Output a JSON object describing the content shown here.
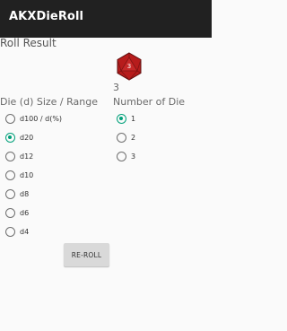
{
  "app": {
    "title": "AKXDieRoll"
  },
  "result": {
    "heading": "Roll Result",
    "die_icon": "d20-die-icon",
    "die_face": "3",
    "value": "3"
  },
  "size_group": {
    "header": "Die (d) Size / Range",
    "options": [
      {
        "label": "d100 / d(%)",
        "checked": false
      },
      {
        "label": "d20",
        "checked": true
      },
      {
        "label": "d12",
        "checked": false
      },
      {
        "label": "d10",
        "checked": false
      },
      {
        "label": "d8",
        "checked": false
      },
      {
        "label": "d6",
        "checked": false
      },
      {
        "label": "d4",
        "checked": false
      }
    ]
  },
  "count_group": {
    "header": "Number of Die",
    "options": [
      {
        "label": "1",
        "checked": true
      },
      {
        "label": "2",
        "checked": false
      },
      {
        "label": "3",
        "checked": false
      }
    ]
  },
  "actions": {
    "reroll_label": "RE-ROLL"
  },
  "colors": {
    "appbar": "#212121",
    "accent": "#00a07a",
    "die_red": "#b71c1c"
  }
}
